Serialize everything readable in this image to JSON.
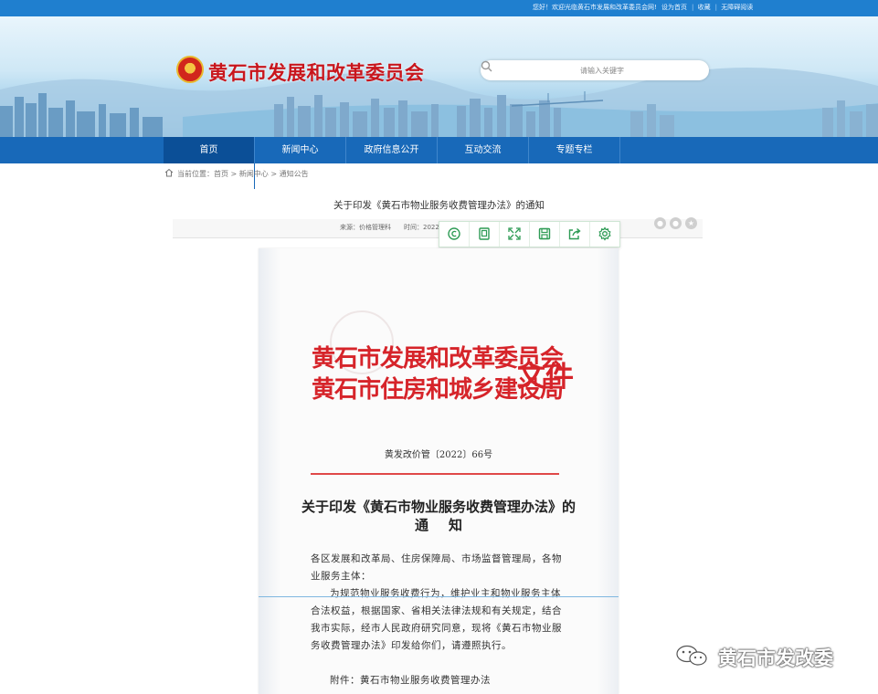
{
  "top_bar": {
    "welcome": "您好！欢迎光临黄石市发展和改革委员会网!",
    "set_home": "设为首页",
    "favorite": "收藏",
    "accessible": "无障碍阅读"
  },
  "header": {
    "site_title": "黄石市发展和改革委员会",
    "search_placeholder": "请输入关键字"
  },
  "nav": {
    "items": [
      {
        "label": "首页"
      },
      {
        "label": "新闻中心"
      },
      {
        "label": "政府信息公开"
      },
      {
        "label": "互动交流"
      },
      {
        "label": "专题专栏"
      }
    ]
  },
  "breadcrumb": {
    "text": "当前位置：首页 > 新闻中心 > 通知公告"
  },
  "article": {
    "title": "关于印发《黄石市物业服务收费管理办法》的通知",
    "source": "来源：价格管理科",
    "time": "时间：2022"
  },
  "toolbar": {
    "icons": [
      "copyright-icon",
      "copy-icon",
      "fullscreen-icon",
      "save-icon",
      "share-out-icon",
      "settings-icon"
    ]
  },
  "document": {
    "head_line_1": "黄石市发展和改革委员会",
    "head_line_2": "黄石市住房和城乡建设局",
    "head_wenjian": "文件",
    "doc_number": "黄发改价管〔2022〕66号",
    "notice_title_1": "关于印发《黄石市物业服务收费管理办法》的",
    "notice_title_2": "通知",
    "para_1": "各区发展和改革局、住房保障局、市场监督管理局，各物业服务主体：",
    "para_2": "为规范物业服务收费行为，维护业主和物业服务主体合法权益，根据国家、省相关法律法规和有关规定，结合我市实际，经市人民政府研究同意，现将《黄石市物业服务收费管理办法》印发给你们，请遵照执行。",
    "para_3": "附件：黄石市物业服务收费管理办法"
  },
  "watermark": {
    "text": "黄石市发改委"
  },
  "colors": {
    "nav_blue": "#1869b9",
    "top_blue": "#1f7fcf",
    "title_red": "#c8161d",
    "doc_red": "#d6242a"
  }
}
